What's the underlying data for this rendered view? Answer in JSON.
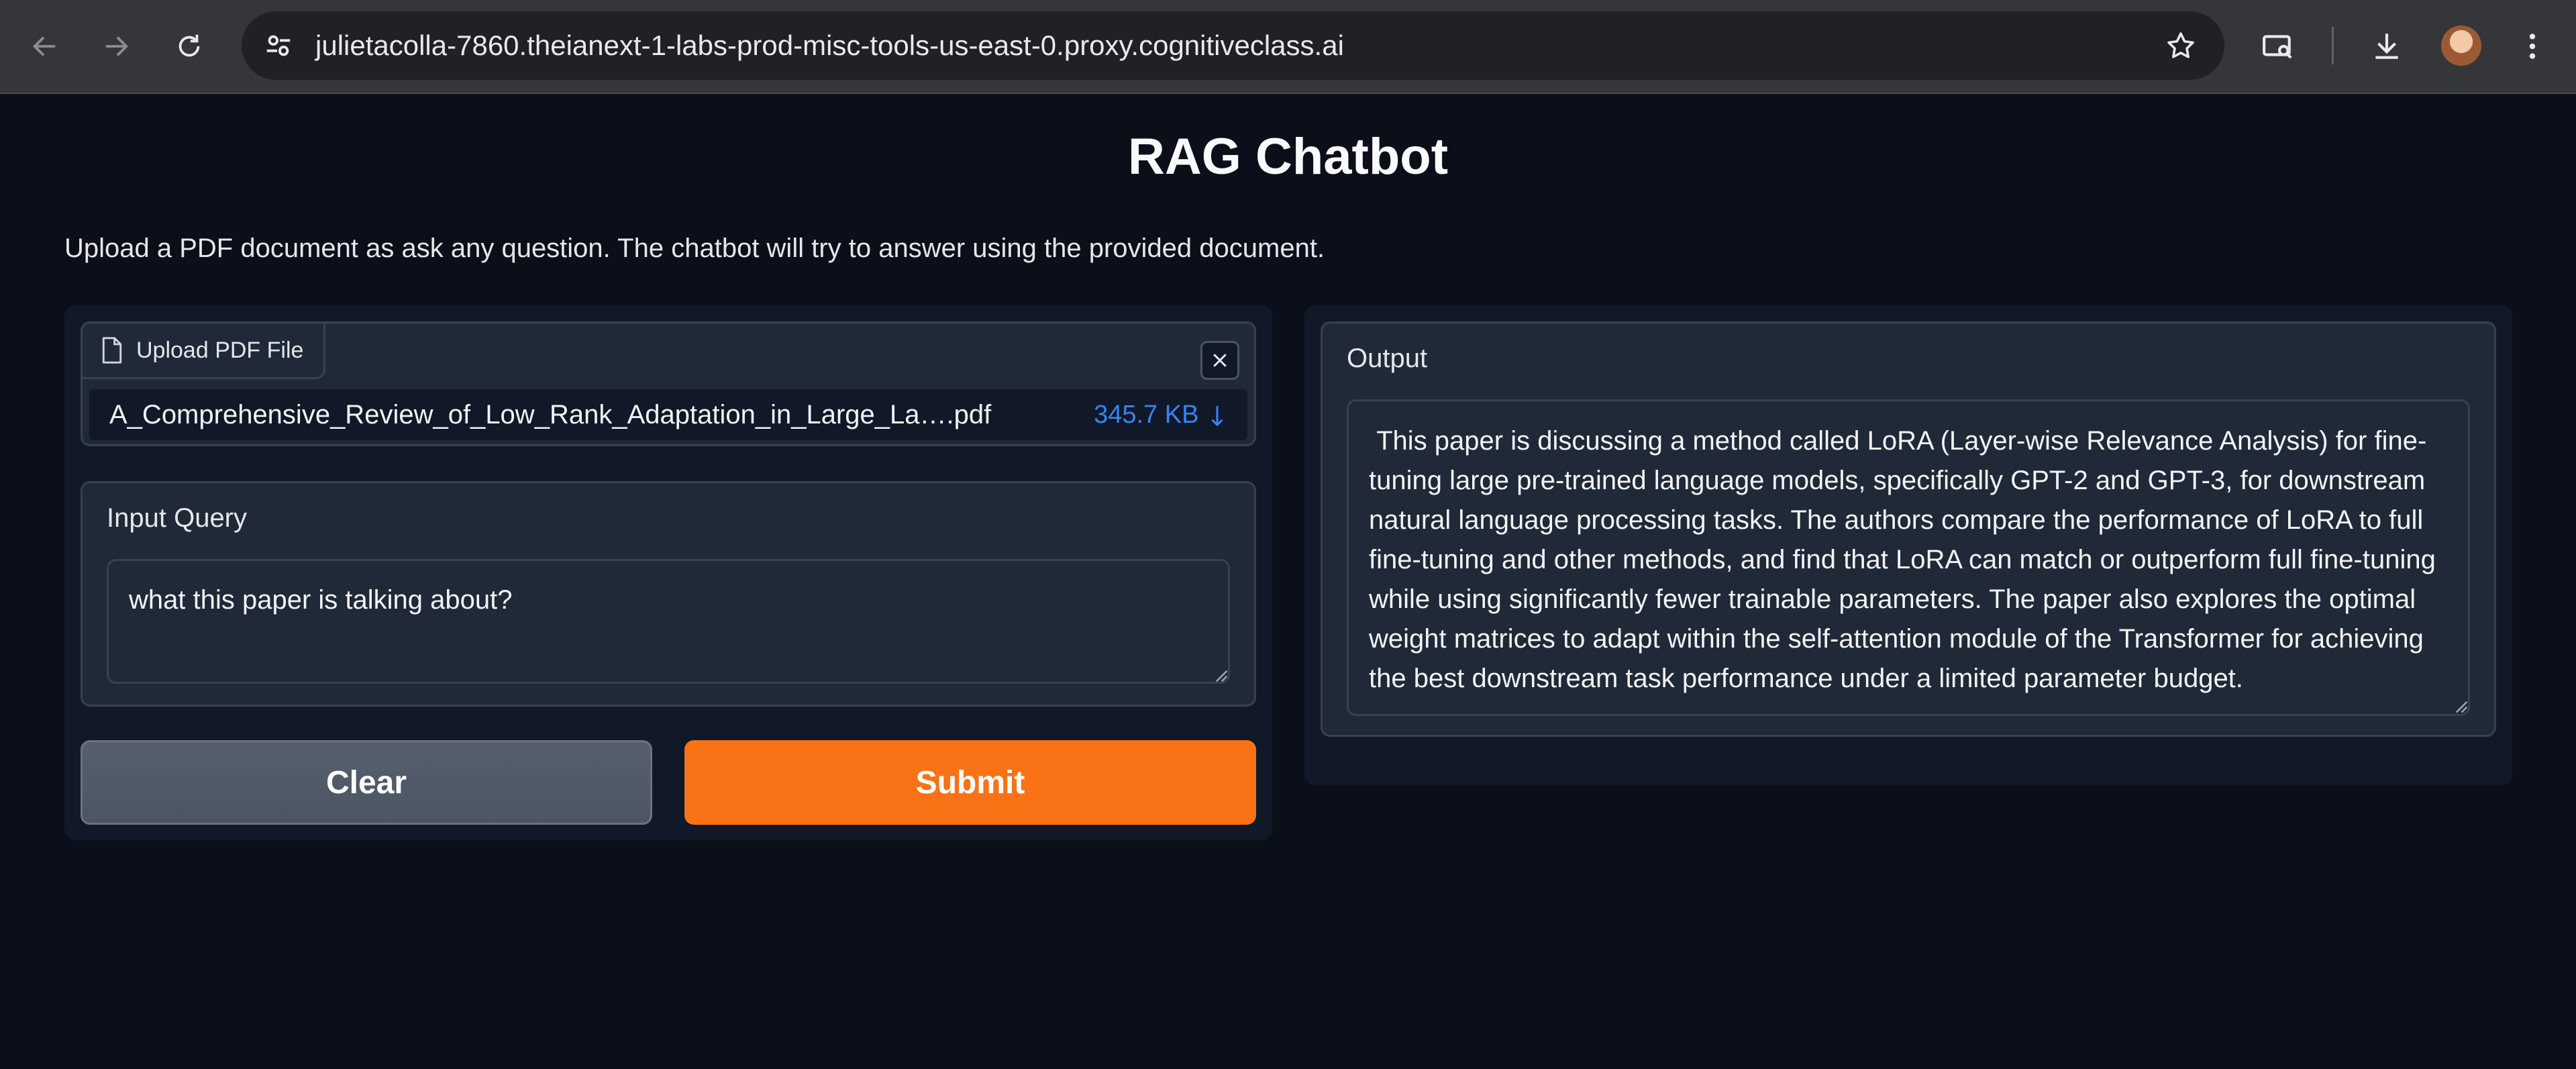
{
  "browser": {
    "url": "julietacolla-7860.theianext-1-labs-prod-misc-tools-us-east-0.proxy.cognitiveclass.ai"
  },
  "app": {
    "title": "RAG Chatbot",
    "description": "Upload a PDF document as ask any question. The chatbot will try to answer using the provided document."
  },
  "upload": {
    "label": "Upload PDF File",
    "file_name": "A_Comprehensive_Review_of_Low_Rank_Adaptation_in_Large_La….pdf",
    "file_size": "345.7 KB"
  },
  "query": {
    "label": "Input Query",
    "value": "what this paper is talking about?"
  },
  "buttons": {
    "clear": "Clear",
    "submit": "Submit"
  },
  "output": {
    "label": "Output",
    "text": " This paper is discussing a method called LoRA (Layer-wise Relevance Analysis) for fine-tuning large pre-trained language models, specifically GPT-2 and GPT-3, for downstream natural language processing tasks. The authors compare the performance of LoRA to full fine-tuning and other methods, and find that LoRA can match or outperform full fine-tuning while using significantly fewer trainable parameters. The paper also explores the optimal weight matrices to adapt within the self-attention module of the Transformer for achieving the best downstream task performance under a limited parameter budget."
  },
  "colors": {
    "background": "#0b0f19",
    "panel": "#111827",
    "block": "#1f2937",
    "accent": "#f97316",
    "file_size_link": "#3b82f6"
  },
  "icons": [
    "back-arrow-icon",
    "forward-arrow-icon",
    "reload-icon",
    "site-info-icon",
    "bookmark-star-icon",
    "search-tab-icon",
    "download-icon",
    "profile-avatar",
    "kebab-menu-icon",
    "file-icon",
    "close-icon",
    "download-arrow-icon",
    "resize-grip-icon"
  ]
}
